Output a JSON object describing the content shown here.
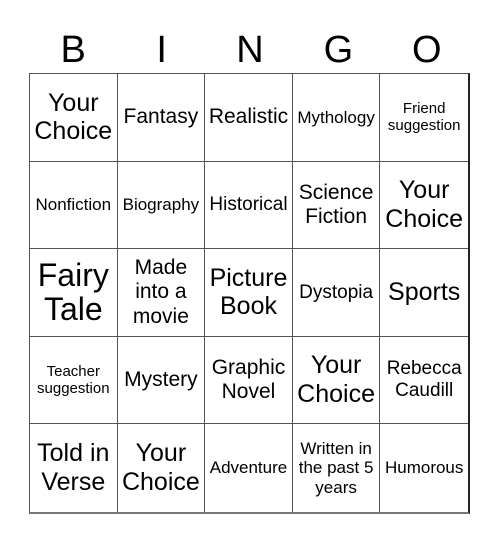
{
  "header": {
    "letters": [
      "B",
      "I",
      "N",
      "G",
      "O"
    ]
  },
  "card": {
    "rows": [
      [
        {
          "text": "Your\nChoice",
          "size": "l"
        },
        {
          "text": "Fantasy",
          "size": "m"
        },
        {
          "text": "Realistic",
          "size": "m"
        },
        {
          "text": "Mythology",
          "size": "xs"
        },
        {
          "text": "Friend\nsuggestion",
          "size": "xxs"
        }
      ],
      [
        {
          "text": "Nonfiction",
          "size": "xs"
        },
        {
          "text": "Biography",
          "size": "xs"
        },
        {
          "text": "Historical",
          "size": "s"
        },
        {
          "text": "Science\nFiction",
          "size": "m"
        },
        {
          "text": "Your\nChoice",
          "size": "l"
        }
      ],
      [
        {
          "text": "Fairy\nTale",
          "size": "xl"
        },
        {
          "text": "Made\ninto a\nmovie",
          "size": "m"
        },
        {
          "text": "Picture\nBook",
          "size": "l"
        },
        {
          "text": "Dystopia",
          "size": "s"
        },
        {
          "text": "Sports",
          "size": "l"
        }
      ],
      [
        {
          "text": "Teacher\nsuggestion",
          "size": "xxs"
        },
        {
          "text": "Mystery",
          "size": "m"
        },
        {
          "text": "Graphic\nNovel",
          "size": "m"
        },
        {
          "text": "Your\nChoice",
          "size": "l"
        },
        {
          "text": "Rebecca\nCaudill",
          "size": "s"
        }
      ],
      [
        {
          "text": "Told in\nVerse",
          "size": "l"
        },
        {
          "text": "Your\nChoice",
          "size": "l"
        },
        {
          "text": "Adventure",
          "size": "xs"
        },
        {
          "text": "Written in\nthe past 5\nyears",
          "size": "xs"
        },
        {
          "text": "Humorous",
          "size": "xs"
        }
      ]
    ]
  }
}
